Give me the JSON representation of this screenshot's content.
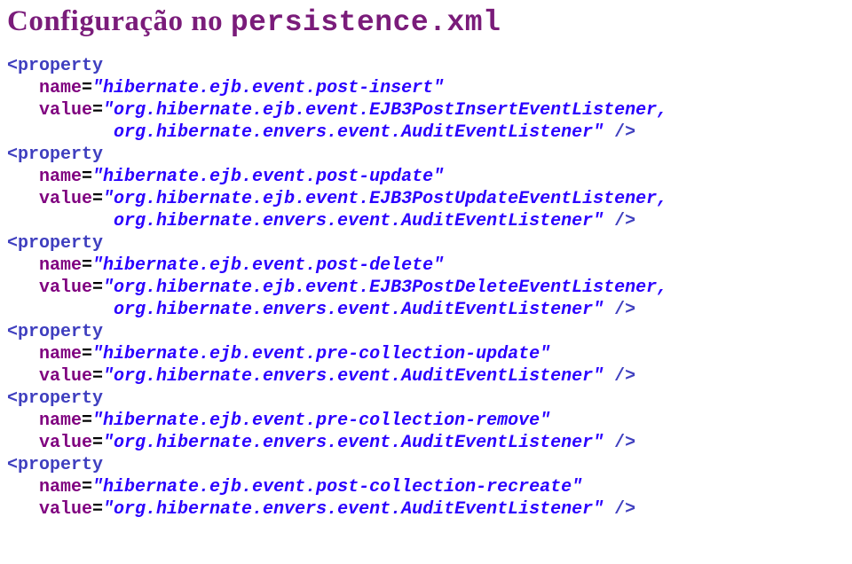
{
  "title": {
    "prefix": "Configuração no ",
    "code": "persistence.xml"
  },
  "properties": [
    {
      "name": "hibernate.ejb.event.post-insert",
      "value_lines": [
        "org.hibernate.ejb.event.EJB3PostInsertEventListener,",
        "org.hibernate.envers.event.AuditEventListener"
      ],
      "value_indent2": "          "
    },
    {
      "name": "hibernate.ejb.event.post-update",
      "value_lines": [
        "org.hibernate.ejb.event.EJB3PostUpdateEventListener,",
        "org.hibernate.envers.event.AuditEventListener"
      ],
      "value_indent2": "          "
    },
    {
      "name": "hibernate.ejb.event.post-delete",
      "value_lines": [
        "org.hibernate.ejb.event.EJB3PostDeleteEventListener,",
        "org.hibernate.envers.event.AuditEventListener"
      ],
      "value_indent2": "          "
    },
    {
      "name": "hibernate.ejb.event.pre-collection-update",
      "value_lines": [
        "org.hibernate.envers.event.AuditEventListener"
      ]
    },
    {
      "name": "hibernate.ejb.event.pre-collection-remove",
      "value_lines": [
        "org.hibernate.envers.event.AuditEventListener"
      ]
    },
    {
      "name": "hibernate.ejb.event.post-collection-recreate",
      "value_lines": [
        "org.hibernate.envers.event.AuditEventListener"
      ]
    }
  ]
}
